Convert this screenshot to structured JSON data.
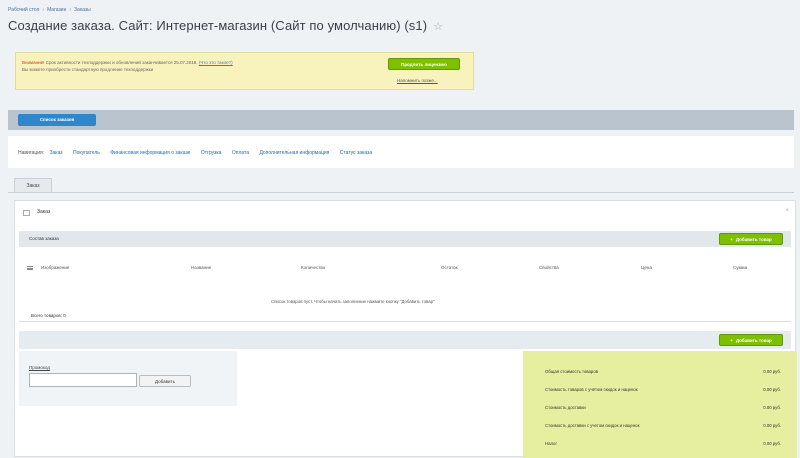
{
  "breadcrumb": {
    "items": [
      "Рабочий стол",
      "Магазин",
      "Заказы"
    ]
  },
  "title": {
    "text": "Создание заказа. Сайт: Интернет-магазин (Сайт по умолчанию) (s1)",
    "star": "☆"
  },
  "notice": {
    "warning_word": "Внимание!",
    "line1_text": "Срок активности техподдержки и обновлений заканчивается 25.07.2018.",
    "line1_link": "(Что это такое?)",
    "line2_text": "Вы можете приобрести стандартную продление техподдержки",
    "buy_button": "Продлить лицензию",
    "sublink": "Напомнить позже..."
  },
  "toolbar": {
    "orders_list_button": "Список заказов"
  },
  "navigation": {
    "label": "Навигация:",
    "links": [
      "Заказ",
      "Покупатель",
      "Финансовая информация о заказе",
      "Отгрузка",
      "Оплата",
      "Дополнительная информация",
      "Статус заказа"
    ]
  },
  "tabs": [
    {
      "label": "Заказ"
    }
  ],
  "panel": {
    "title": "Заказ",
    "close_icon": "×",
    "section_title": "Состав заказа",
    "add_button": "Добавить товар",
    "columns": [
      "Изображение",
      "Название",
      "Количество",
      "Остаток",
      "Свойства",
      "Цена",
      "Сумма"
    ],
    "empty_message": "Список товаров пуст. Чтобы начать заполнение нажмите кнопку \"Добавить товар\"",
    "total_count": "Всего товаров: 0",
    "add_button_bottom": "Добавить товар"
  },
  "promo": {
    "label": "Промокод",
    "input_value": "",
    "apply_button": "Добавить"
  },
  "totals": [
    {
      "label": "Общая стоимость товаров",
      "value": "0.00 руб."
    },
    {
      "label": "Стоимость товаров с учётом скидок и наценок",
      "value": "0.00 руб."
    },
    {
      "label": "Стоимость доставки",
      "value": "0.00 руб."
    },
    {
      "label": "Стоимость доставки с учетом скидок и наценок",
      "value": "0.00 руб."
    },
    {
      "label": "Налог",
      "value": "0.00 руб."
    }
  ],
  "colors": {
    "green": "#7ec000",
    "blue": "#2f86c8",
    "notice_bg": "#f8f3bd",
    "totals_bg": "#e6ef9f"
  }
}
